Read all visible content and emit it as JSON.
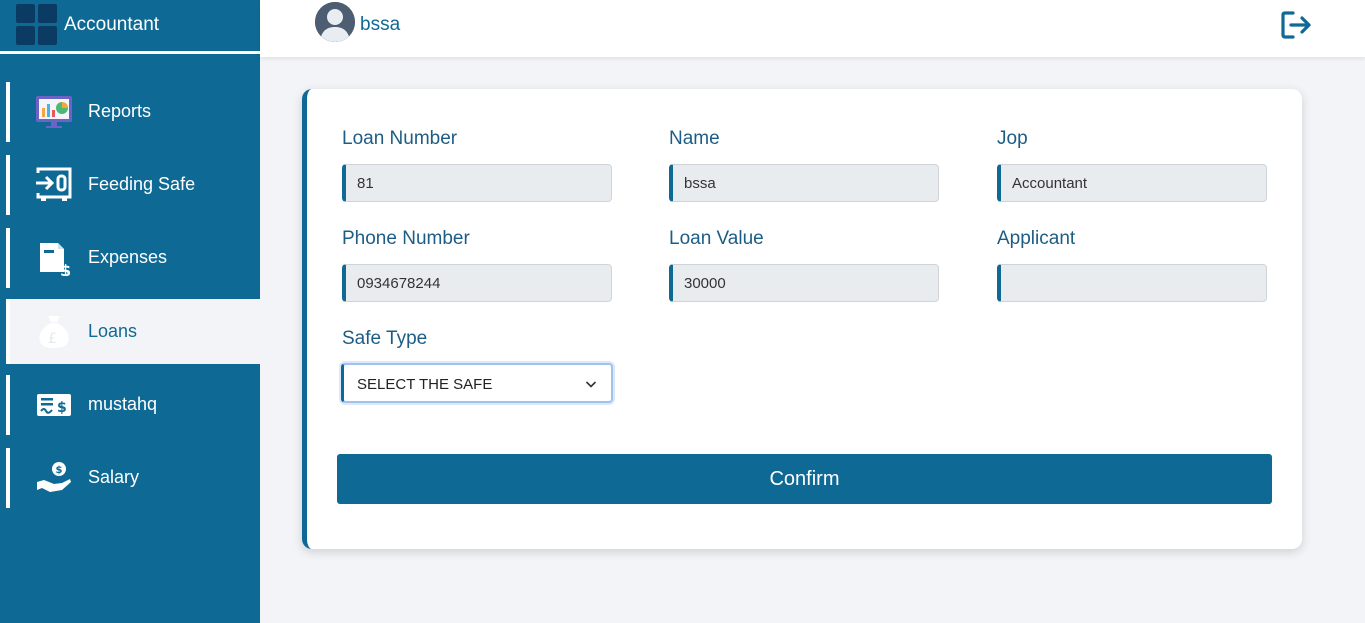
{
  "app": {
    "title": "Accountant"
  },
  "header": {
    "user_name": "bssa",
    "logout_icon": "logout-icon"
  },
  "sidebar": {
    "items": [
      {
        "label": "Reports",
        "icon": "reports-icon",
        "active": false
      },
      {
        "label": "Feeding Safe",
        "icon": "feeding-safe-icon",
        "active": false
      },
      {
        "label": "Expenses",
        "icon": "expenses-icon",
        "active": false
      },
      {
        "label": "Loans",
        "icon": "money-bag-icon",
        "active": true
      },
      {
        "label": "mustahq",
        "icon": "cheque-icon",
        "active": false
      },
      {
        "label": "Salary",
        "icon": "salary-hand-icon",
        "active": false
      }
    ]
  },
  "form": {
    "loan_number": {
      "label": "Loan Number",
      "value": "81"
    },
    "name": {
      "label": "Name",
      "value": "bssa"
    },
    "job": {
      "label": "Jop",
      "value": "Accountant"
    },
    "phone_number": {
      "label": "Phone Number",
      "value": "0934678244"
    },
    "loan_value": {
      "label": "Loan Value",
      "value": "30000"
    },
    "applicant": {
      "label": "Applicant",
      "value": ""
    },
    "safe_type": {
      "label": "Safe Type",
      "selected": "SELECT THE SAFE"
    },
    "confirm_label": "Confirm"
  },
  "colors": {
    "primary": "#0e6a94",
    "background": "#f3f4f7",
    "label": "#1d5d85"
  }
}
